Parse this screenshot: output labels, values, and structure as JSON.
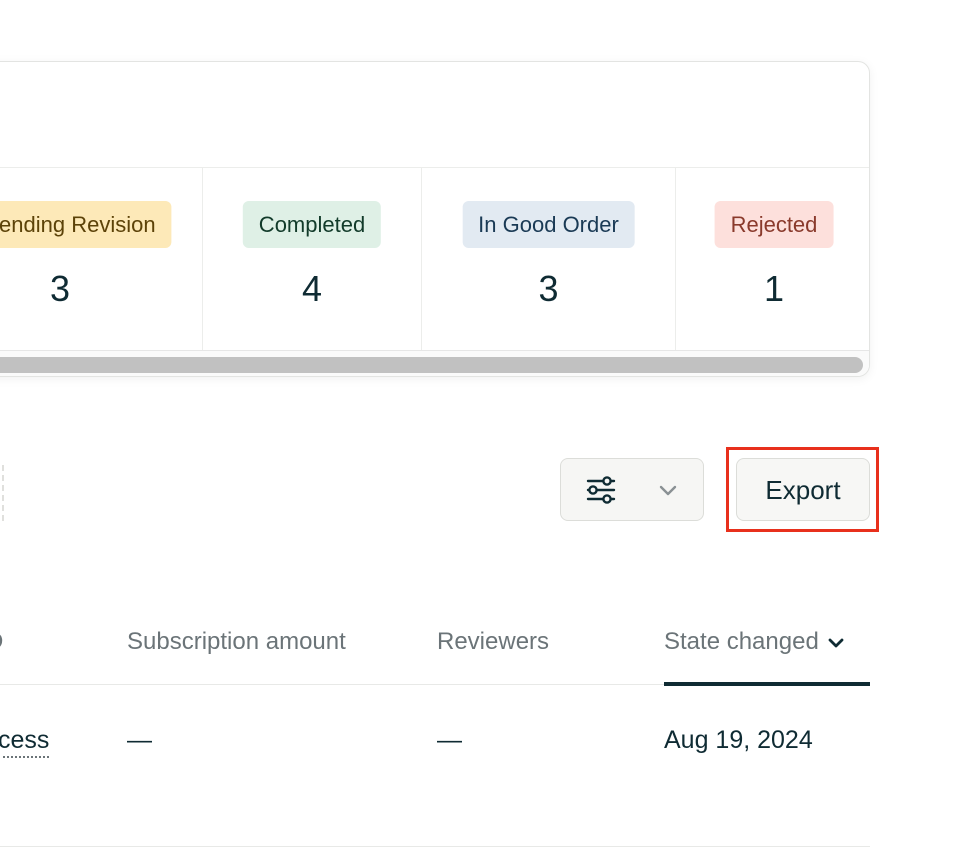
{
  "status_summary": {
    "tiles": [
      {
        "label": "Pending Revision",
        "count": "3",
        "badge_bg": "#fde9b8",
        "badge_fg": "#5c4208"
      },
      {
        "label": "Completed",
        "count": "4",
        "badge_bg": "#dff0e6",
        "badge_fg": "#123b2a"
      },
      {
        "label": "In Good Order",
        "count": "3",
        "badge_bg": "#e2eaf2",
        "badge_fg": "#1a3a55"
      },
      {
        "label": "Rejected",
        "count": "1",
        "badge_bg": "#fde0dc",
        "badge_fg": "#8a3a2c"
      }
    ]
  },
  "toolbar": {
    "filter_icon": "sliders-icon",
    "dropdown_icon": "chevron-down-icon",
    "export_label": "Export"
  },
  "table": {
    "columns": [
      {
        "label": "D"
      },
      {
        "label": "Subscription amount"
      },
      {
        "label": "Reviewers"
      },
      {
        "label": "State changed",
        "sort_icon": "chevron-down-icon",
        "active": true
      }
    ],
    "rows": [
      {
        "cells": [
          "cess",
          "—",
          "—",
          "Aug 19, 2024"
        ]
      }
    ]
  },
  "colors": {
    "text_primary": "#0f2b33",
    "text_muted": "#6b7478",
    "highlight": "#e8301c"
  }
}
